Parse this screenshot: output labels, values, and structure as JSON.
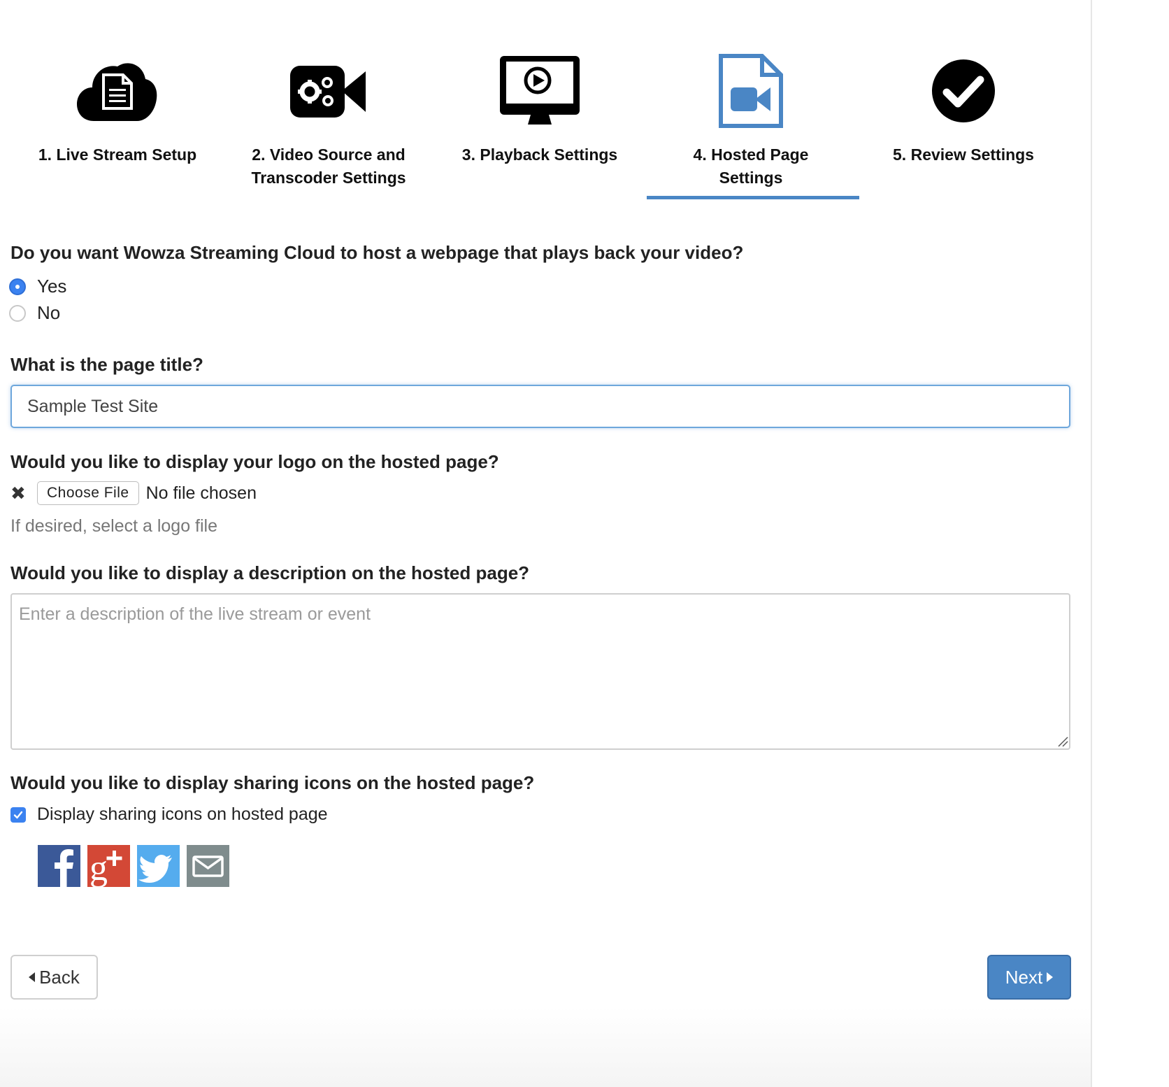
{
  "steps": [
    {
      "label_line1": "1. Live Stream Setup",
      "label_line2": "",
      "icon": "cloud-document-icon",
      "active": false
    },
    {
      "label_line1": "2. Video Source and",
      "label_line2": "Transcoder Settings",
      "icon": "video-camera-gears-icon",
      "active": false
    },
    {
      "label_line1": "3. Playback Settings",
      "label_line2": "",
      "icon": "monitor-play-icon",
      "active": false
    },
    {
      "label_line1": "4. Hosted Page",
      "label_line2": "Settings",
      "icon": "file-video-icon",
      "active": true
    },
    {
      "label_line1": "5. Review Settings",
      "label_line2": "",
      "icon": "check-circle-icon",
      "active": false
    }
  ],
  "colors": {
    "accent": "#4a86c5",
    "radio_checked": "#3b82f0",
    "facebook": "#3b5998",
    "google_plus": "#d34836",
    "twitter": "#55acee",
    "email": "#7f8c8d"
  },
  "host_question": {
    "text": "Do you want Wowza Streaming Cloud to host a webpage that plays back your video?",
    "options": [
      {
        "label": "Yes",
        "selected": true
      },
      {
        "label": "No",
        "selected": false
      }
    ]
  },
  "title_question": {
    "text": "What is the page title?",
    "value": "Sample Test Site"
  },
  "logo_question": {
    "text": "Would you like to display your logo on the hosted page?",
    "choose_label": "Choose File",
    "file_status": "No file chosen",
    "hint": "If desired, select a logo file"
  },
  "description_question": {
    "text": "Would you like to display a description on the hosted page?",
    "placeholder": "Enter a description of the live stream or event",
    "value": ""
  },
  "sharing_question": {
    "text": "Would you like to display sharing icons on the hosted page?",
    "checkbox_label": "Display sharing icons on hosted page",
    "checked": true,
    "icons": [
      "facebook-icon",
      "google-plus-icon",
      "twitter-icon",
      "email-icon"
    ]
  },
  "nav": {
    "back_label": "Back",
    "next_label": "Next"
  }
}
